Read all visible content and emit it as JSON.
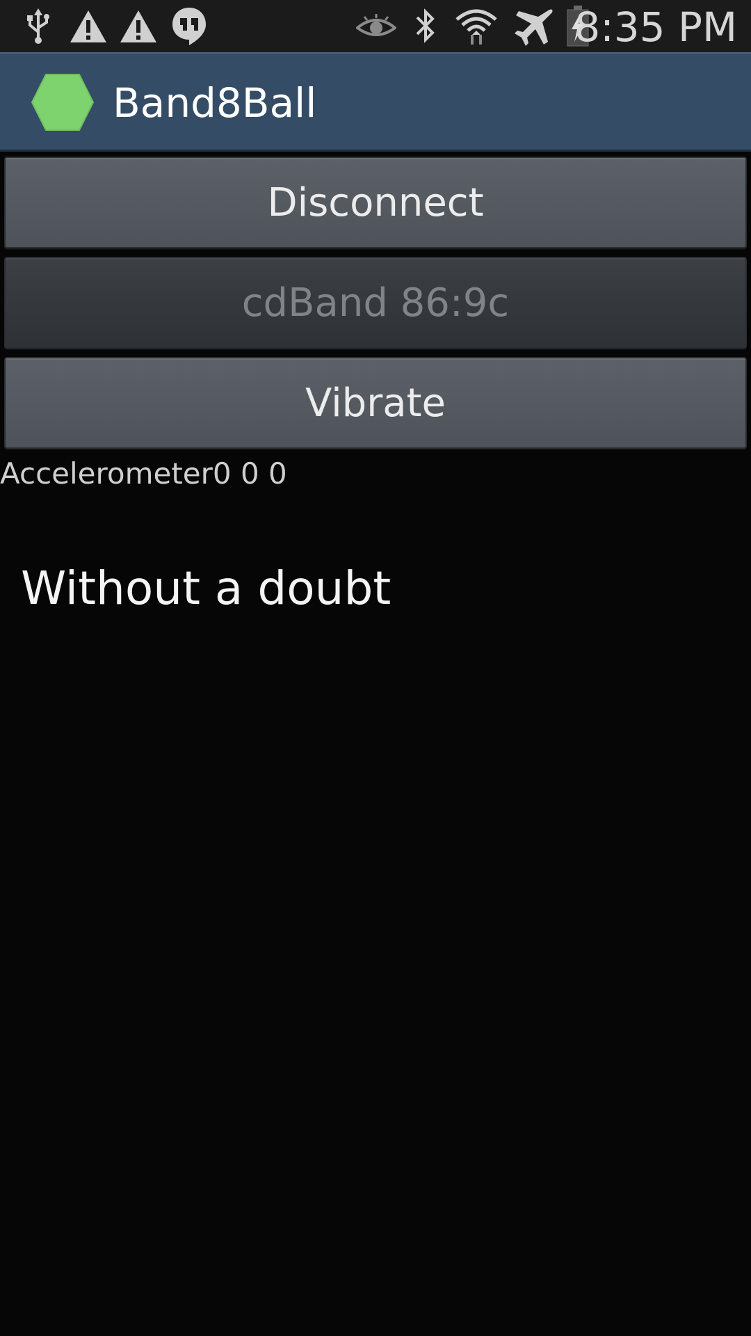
{
  "status_bar": {
    "icons_left": [
      "usb-icon",
      "warning-icon",
      "warning-icon",
      "hangouts-icon"
    ],
    "icons_right": [
      "eye-icon",
      "bluetooth-icon",
      "wifi-icon",
      "airplane-icon",
      "battery-charging-icon"
    ],
    "time": "8:35 PM"
  },
  "action_bar": {
    "title": "Band8Ball",
    "logo_color": "#7ed36f",
    "background_color": "#344c66"
  },
  "buttons": {
    "disconnect": "Disconnect",
    "device": "cdBand 86:9c",
    "vibrate": "Vibrate"
  },
  "accelerometer": {
    "text": "Accelerometer0 0 0"
  },
  "answer": {
    "text": "Without a doubt"
  }
}
